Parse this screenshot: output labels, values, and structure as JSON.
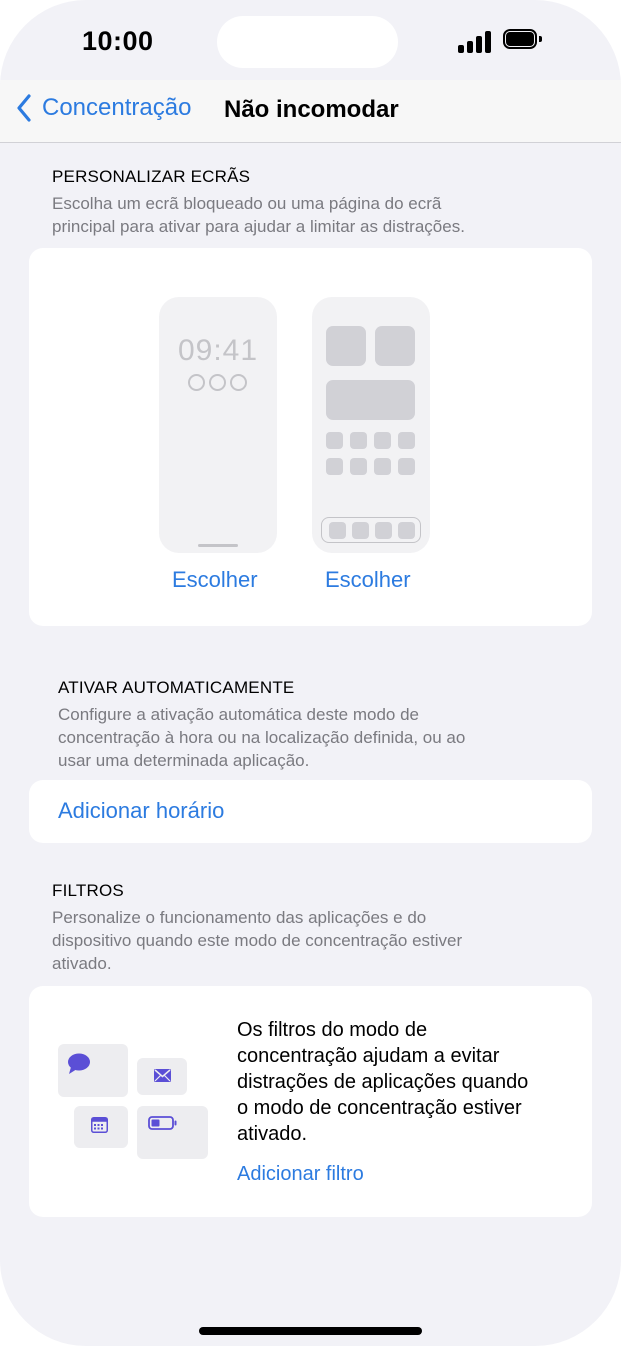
{
  "status_bar": {
    "time": "10:00"
  },
  "nav": {
    "back_label": "Concentração",
    "title": "Não incomodar"
  },
  "personalize": {
    "heading": "PERSONALIZAR ECRÃS",
    "description_line1": "Escolha um ecrã bloqueado ou uma página do ecrã",
    "description_line2": "principal para ativar para ajudar a limitar as distrações.",
    "lock_screen_time": "09:41",
    "choose_lock_label": "Escolher",
    "choose_home_label": "Escolher"
  },
  "auto_activate": {
    "heading": "ATIVAR AUTOMATICAMENTE",
    "description_line1": "Configure a ativação automática deste modo de",
    "description_line2": "concentração à hora ou na localização definida, ou ao",
    "description_line3": "usar uma determinada aplicação.",
    "add_schedule_label": "Adicionar horário"
  },
  "filters": {
    "heading": "FILTROS",
    "description_line1": "Personalize o funcionamento das aplicações e do",
    "description_line2": "dispositivo quando este modo de concentração estiver",
    "description_line3": "ativado.",
    "info_line1": "Os filtros do modo de",
    "info_line2": "concentração ajudam a evitar",
    "info_line3": "distrações de aplicações quando",
    "info_line4": "o modo de concentração estiver",
    "info_line5": "ativado.",
    "add_filter_label": "Adicionar filtro",
    "icons": [
      "message-icon",
      "mail-icon",
      "calendar-icon",
      "battery-icon"
    ]
  },
  "colors": {
    "accent": "#2c7be0",
    "icon_purple": "#5b4fd6",
    "background": "#f2f2f7"
  }
}
